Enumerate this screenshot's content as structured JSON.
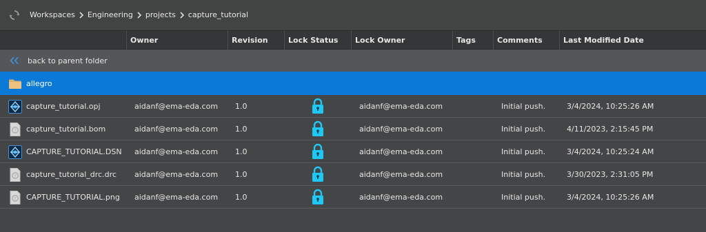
{
  "breadcrumb": [
    "Workspaces",
    "Engineering",
    "projects",
    "capture_tutorial"
  ],
  "columns": {
    "owner": "Owner",
    "revision": "Revision",
    "lock_status": "Lock Status",
    "lock_owner": "Lock Owner",
    "tags": "Tags",
    "comments": "Comments",
    "last_modified": "Last Modified Date"
  },
  "back_label": "back to parent folder",
  "folder": {
    "name": "allegro",
    "icon": "folder-icon"
  },
  "files": [
    {
      "name": "capture_tutorial.opj",
      "icon": "capture-project-icon",
      "owner": "aidanf@ema-eda.com",
      "revision": "1.0",
      "lock": "locked",
      "lock_owner": "aidanf@ema-eda.com",
      "tags": "",
      "comments": "Initial push.",
      "modified": "3/4/2024, 10:25:26 AM"
    },
    {
      "name": "capture_tutorial.bom",
      "icon": "generic-file-icon",
      "owner": "aidanf@ema-eda.com",
      "revision": "1.0",
      "lock": "locked",
      "lock_owner": "aidanf@ema-eda.com",
      "tags": "",
      "comments": "Initial push.",
      "modified": "4/11/2023, 2:15:45 PM"
    },
    {
      "name": "CAPTURE_TUTORIAL.DSN",
      "icon": "capture-project-icon",
      "owner": "aidanf@ema-eda.com",
      "revision": "1.0",
      "lock": "locked",
      "lock_owner": "aidanf@ema-eda.com",
      "tags": "",
      "comments": "Initial push.",
      "modified": "3/4/2024, 10:25:24 AM"
    },
    {
      "name": "capture_tutorial_drc.drc",
      "icon": "generic-file-icon",
      "owner": "aidanf@ema-eda.com",
      "revision": "1.0",
      "lock": "locked",
      "lock_owner": "aidanf@ema-eda.com",
      "tags": "",
      "comments": "Initial push.",
      "modified": "3/30/2023, 2:31:05 PM"
    },
    {
      "name": "CAPTURE_TUTORIAL.png",
      "icon": "generic-file-icon",
      "owner": "aidanf@ema-eda.com",
      "revision": "1.0",
      "lock": "locked",
      "lock_owner": "aidanf@ema-eda.com",
      "tags": "",
      "comments": "Initial push.",
      "modified": "3/4/2024, 10:25:26 AM"
    }
  ],
  "colors": {
    "selected_row": "#0a79d8",
    "lock_icon": "#1ec8f5",
    "back_arrows": "#3d8fe0",
    "folder": "#e2b06a"
  }
}
